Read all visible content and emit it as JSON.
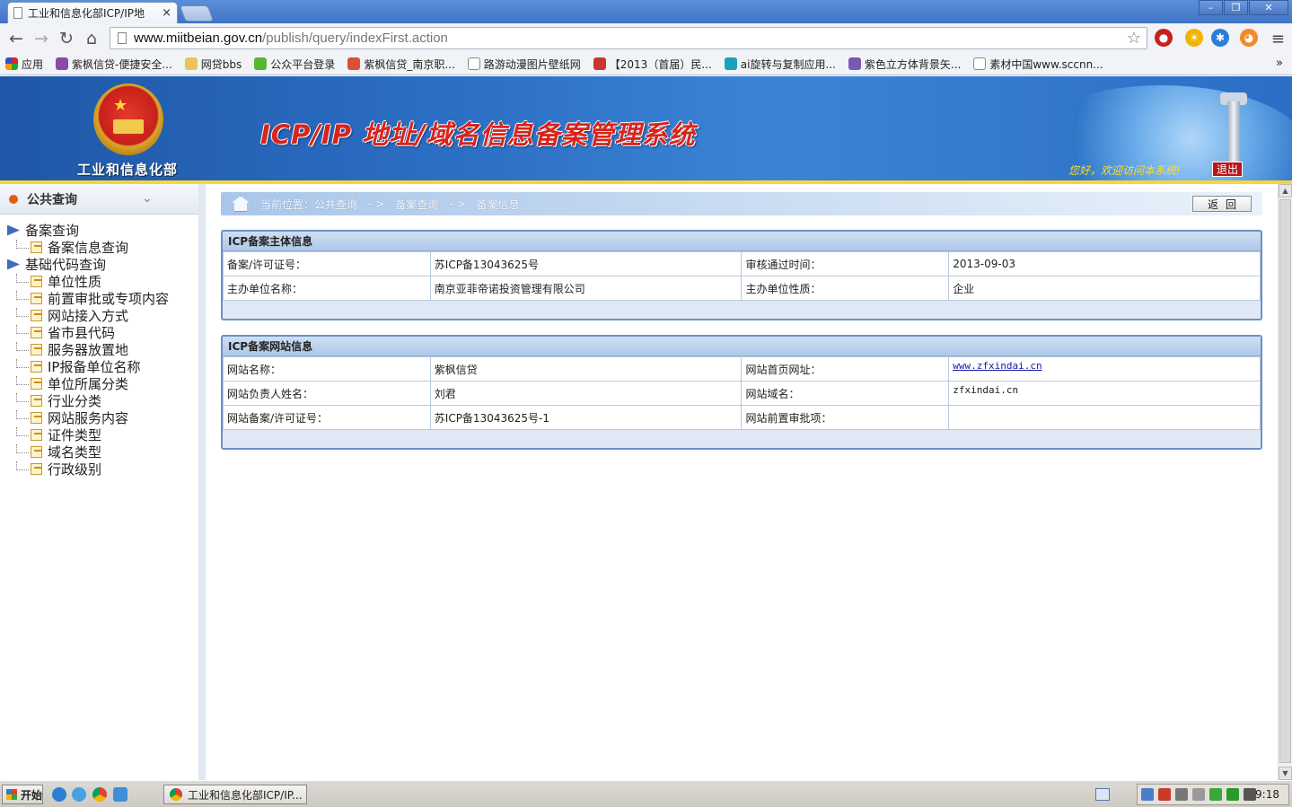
{
  "browser": {
    "tab_title": "工业和信息化部ICP/IP地",
    "tab_close": "×",
    "url_host": "www.miitbeian.gov.cn",
    "url_path": "/publish/query/indexFirst.action",
    "window_buttons": {
      "minimize": "–",
      "restore": "❐",
      "close": "✕"
    },
    "nav": {
      "back": "←",
      "forward": "→",
      "reload": "↻",
      "home": "⌂"
    },
    "star": "☆",
    "menu": "≡"
  },
  "bookmarks": {
    "apps": "应用",
    "items": [
      {
        "label": "紫枫信贷-便捷安全...",
        "icon": "s-logo-icon",
        "color": "#8a4aa6"
      },
      {
        "label": "网贷bbs",
        "icon": "folder-icon",
        "color": "#e8c45a"
      },
      {
        "label": "公众平台登录",
        "icon": "wechat-icon",
        "color": "#5cb531"
      },
      {
        "label": "紫枫信贷_南京职...",
        "icon": "pinwheel-icon",
        "color": "#d8503a"
      },
      {
        "label": "路游动漫图片壁纸网",
        "icon": "page-icon",
        "color": "#ffffff"
      },
      {
        "label": "【2013（首届）民...",
        "icon": "badge-icon",
        "color": "#c8372d"
      },
      {
        "label": "ai旋转与复制应用...",
        "icon": "y-logo-icon",
        "color": "#1aa0b8"
      },
      {
        "label": "紫色立方体背景矢...",
        "icon": "s-arrow-icon",
        "color": "#7a5ab0"
      },
      {
        "label": "素材中国www.sccnn...",
        "icon": "page-icon",
        "color": "#ffffff"
      }
    ],
    "more": "»"
  },
  "header": {
    "ministry": "工业和信息化部",
    "system_title": "ICP/IP 地址/域名信息备案管理系统",
    "welcome": "您好，欢迎访问本系统!",
    "logout": "退出"
  },
  "sidebar": {
    "title": "公共查询",
    "groups": [
      {
        "label": "备案查询",
        "children": [
          "备案信息查询"
        ]
      },
      {
        "label": "基础代码查询",
        "children": [
          "单位性质",
          "前置审批或专项内容",
          "网站接入方式",
          "省市县代码",
          "服务器放置地",
          "IP报备单位名称",
          "单位所属分类",
          "行业分类",
          "网站服务内容",
          "证件类型",
          "域名类型",
          "行政级别"
        ]
      }
    ]
  },
  "breadcrumb": {
    "prefix": "当前位置：公共查询",
    "sep": "- >",
    "level2": "备案查询",
    "level3": "备案信息"
  },
  "back_button": "返回",
  "entity_panel": {
    "title": "ICP备案主体信息",
    "rows": [
      {
        "l1": "备案/许可证号：",
        "v1": "苏ICP备13043625号",
        "l2": "审核通过时间：",
        "v2": "2013-09-03"
      },
      {
        "l1": "主办单位名称：",
        "v1": "南京亚菲帝诺投资管理有限公司",
        "l2": "主办单位性质：",
        "v2": "企业"
      }
    ]
  },
  "site_panel": {
    "title": "ICP备案网站信息",
    "rows": [
      {
        "l1": "网站名称：",
        "v1": "紫枫信贷",
        "l2": "网站首页网址：",
        "v2": "www.zfxindai.cn"
      },
      {
        "l1": "网站负责人姓名：",
        "v1": "刘君",
        "l2": "网站域名：",
        "v2": "zfxindai.cn"
      },
      {
        "l1": "网站备案/许可证号：",
        "v1": "苏ICP备13043625号-1",
        "l2": "网站前置审批项：",
        "v2": ""
      }
    ]
  },
  "taskbar": {
    "start": "开始",
    "task_item": "工业和信息化部ICP/IP...",
    "clock": "9:18"
  }
}
